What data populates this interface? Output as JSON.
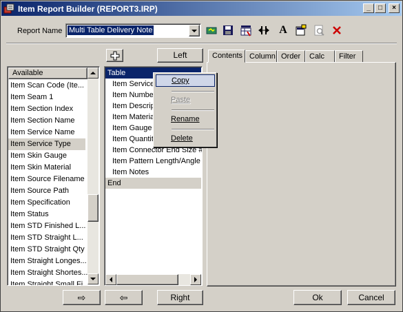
{
  "window": {
    "title": "Item Report Builder (REPORT3.IRP)",
    "controls": {
      "minimize": "_",
      "maximize": "□",
      "close": "×"
    }
  },
  "report_name": {
    "label": "Report Name",
    "value": "Multi Table Delivery Note"
  },
  "toolbar": {
    "icons": [
      "new-report-icon",
      "save-icon",
      "grid-icon",
      "column-width-icon",
      "font-icon",
      "properties-icon",
      "print-preview-icon",
      "delete-icon"
    ],
    "font_glyph": "A"
  },
  "available": {
    "header": "Available",
    "items": [
      "Item Scan Code (Ite...",
      "Item Seam 1",
      "Item Section Index",
      "Item Section Name",
      "Item Service Name",
      "Item Service Type",
      "Item Skin Gauge",
      "Item Skin Material",
      "Item Source Filename",
      "Item Source Path",
      "Item Specification",
      "Item Status",
      "Item STD Finished L...",
      "Item STD Straight L...",
      "Item STD Straight Qty",
      "Item Straight Longes...",
      "Item Straight Shortes...",
      "Item Straight Small Fi..."
    ],
    "selected_index": 5
  },
  "middle": {
    "left_button": "Left",
    "items": [
      "Table",
      "Item Service",
      "Item Number",
      "Item Descrip",
      "Item Materia",
      "Item Gauge",
      "Item Quantity",
      "Item Connector End Size #",
      "Item Pattern Length/Angle",
      "Item Notes",
      "End"
    ]
  },
  "tabs": [
    "Contents",
    "Column",
    "Order",
    "Calc",
    "Filter"
  ],
  "context_menu": {
    "items": [
      {
        "label": "Copy",
        "enabled": true,
        "highlighted": true
      },
      {
        "label": "Paste",
        "enabled": false
      },
      {
        "label": "Rename",
        "enabled": true
      },
      {
        "label": "Delete",
        "enabled": true
      }
    ]
  },
  "bottom": {
    "add_arrow": "⇨",
    "remove_arrow": "⇦",
    "right_button": "Right",
    "ok": "Ok",
    "cancel": "Cancel"
  }
}
